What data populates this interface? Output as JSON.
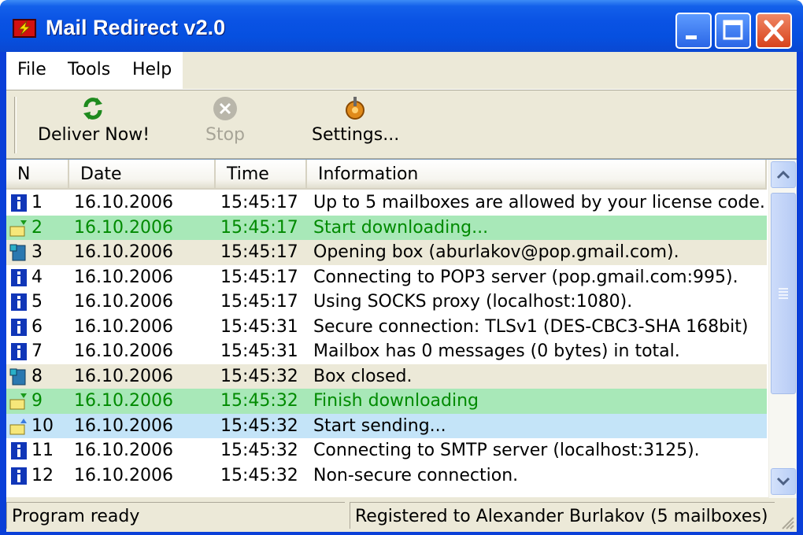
{
  "window": {
    "title": "Mail Redirect v2.0"
  },
  "menu": [
    "File",
    "Tools",
    "Help"
  ],
  "toolbar": {
    "deliver_label": "Deliver Now!",
    "stop_label": "Stop",
    "settings_label": "Settings..."
  },
  "list": {
    "columns": [
      "N",
      "Date",
      "Time",
      "Information"
    ],
    "rows": [
      {
        "n": "1",
        "date": "16.10.2006",
        "time": "15:45:17",
        "info": "Up to 5 mailboxes are allowed by your license code.",
        "icon": "info-icon"
      },
      {
        "n": "2",
        "date": "16.10.2006",
        "time": "15:45:17",
        "info": "Start downloading...",
        "icon": "download-icon"
      },
      {
        "n": "3",
        "date": "16.10.2006",
        "time": "15:45:17",
        "info": "Opening box (aburlakov@pop.gmail.com).",
        "icon": "mailbox-icon"
      },
      {
        "n": "4",
        "date": "16.10.2006",
        "time": "15:45:17",
        "info": "Connecting to POP3 server (pop.gmail.com:995).",
        "icon": "info-icon"
      },
      {
        "n": "5",
        "date": "16.10.2006",
        "time": "15:45:17",
        "info": "Using SOCKS proxy (localhost:1080).",
        "icon": "info-icon"
      },
      {
        "n": "6",
        "date": "16.10.2006",
        "time": "15:45:31",
        "info": "Secure connection: TLSv1 (DES-CBC3-SHA 168bit)",
        "icon": "info-icon"
      },
      {
        "n": "7",
        "date": "16.10.2006",
        "time": "15:45:31",
        "info": "Mailbox has 0 messages (0 bytes) in total.",
        "icon": "info-icon"
      },
      {
        "n": "8",
        "date": "16.10.2006",
        "time": "15:45:32",
        "info": "Box closed.",
        "icon": "mailbox-icon"
      },
      {
        "n": "9",
        "date": "16.10.2006",
        "time": "15:45:32",
        "info": "Finish downloading",
        "icon": "download-icon"
      },
      {
        "n": "10",
        "date": "16.10.2006",
        "time": "15:45:32",
        "info": "Start sending...",
        "icon": "upload-icon"
      },
      {
        "n": "11",
        "date": "16.10.2006",
        "time": "15:45:32",
        "info": "Connecting to SMTP server (localhost:3125).",
        "icon": "info-icon"
      },
      {
        "n": "12",
        "date": "16.10.2006",
        "time": "15:45:32",
        "info": "Non-secure connection.",
        "icon": "info-icon"
      }
    ]
  },
  "status": {
    "left": "Program ready",
    "right": "Registered to Alexander Burlakov (5 mailboxes)"
  },
  "colors": {
    "title_bar": "#0a53e4",
    "row_green_bg": "#a8e8b8",
    "row_green_text": "#008a00",
    "row_beige_bg": "#ece9d8",
    "row_blue_bg": "#c4e4f8"
  }
}
